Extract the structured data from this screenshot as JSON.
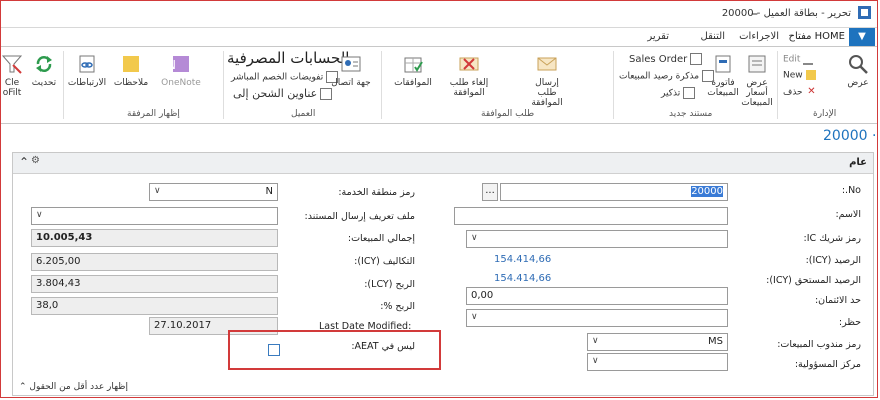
{
  "window": {
    "title": "تحرير - بطاقة العميل - 20000",
    "dash": "–"
  },
  "menu": {
    "button": "▼",
    "tabs": [
      "مفتاح HOME",
      "الاجراءات",
      "التنقل",
      "تقرير"
    ]
  },
  "ribbon": {
    "groups": {
      "process": "الإدارة",
      "new_document": "مستند جديد",
      "approval_request": "طلب الموافقة",
      "customer": "العميل",
      "show_attached": "إظهار المرفقة"
    },
    "view": "عرض",
    "edit": "Edit",
    "new": "New",
    "delete": "حذف",
    "sales_prices": "عرض أسعار المبيعات",
    "sales_invoice": "فاتورة المبيعات",
    "sales_order": "Sales Order",
    "sales_credit_memo": "مذكرة رصيد المبيعات",
    "reminder": "تذكير",
    "send_approval": "إرسال طلب الموافقة",
    "cancel_approval": "إلغاء طلب الموافقة",
    "approvals": "الموافقات",
    "bank_accounts": "الحسابات المصرفية",
    "direct_debit": "تفويضات الخصم المباشر",
    "ship_to": "عناوين الشحن إلى",
    "contact": "جهة اتصال",
    "onenote": "OneNote",
    "notes": "ملاحظات",
    "links": "الارتباطات",
    "refresh": "تحديث",
    "clear_filter": "Cle oFilt"
  },
  "record_title": "20000 ·",
  "section": {
    "title": "عام",
    "caret": "⌃",
    "gear": "⚙"
  },
  "fields_right": {
    "no_label": "No.:",
    "no_value": "20000",
    "no_assist": "...",
    "name_label": "الاسم:",
    "name_value": "",
    "ic_partner_label": "رمز شريك IC:",
    "ic_partner_value": "",
    "balance_label": "الرصيد (ICY):",
    "balance_value": "154.414,66",
    "balance_due_label": "الرصيد المستحق (ICY):",
    "balance_due_value": "154.414,66",
    "credit_limit_label": "حد الائتمان:",
    "credit_limit_value": "0,00",
    "blocked_label": "حظر:",
    "blocked_value": "",
    "salesperson_label": "رمز مندوب المبيعات:",
    "salesperson_value": "MS",
    "resp_center_label": "مركز المسؤولية:",
    "resp_center_value": ""
  },
  "fields_left": {
    "service_zone_label": "رمز منطقة الخدمة:",
    "service_zone_value": "N",
    "doc_sending_label": "ملف تعريف إرسال المستند:",
    "doc_sending_value": "",
    "total_sales_label": "إجمالي المبيعات:",
    "total_sales_value": "10.005,43",
    "costs_label": "التكاليف (ICY):",
    "costs_value": "6.205,00",
    "profit_label": "الربح (LCY):",
    "profit_value": "3.804,43",
    "profit_pct_label": "الربح %:",
    "profit_pct_value": "38,0",
    "last_modified_label": "Last Date Modified:",
    "last_modified_value": "27.10.2017",
    "aeat_label": "ليس في AEAT:"
  },
  "footer": {
    "show_fewer": "إظهار عدد أقل من الحقول",
    "caret": "⌃"
  },
  "colors": {
    "accent": "#1e73be",
    "highlight": "#d23a3a"
  }
}
